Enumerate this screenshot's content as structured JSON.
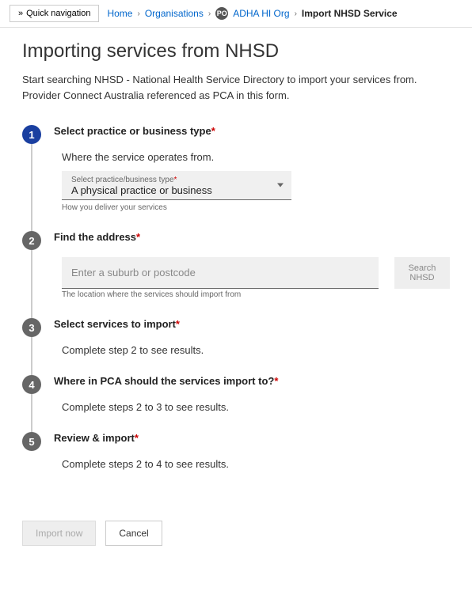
{
  "topbar": {
    "quicknav": "Quick navigation",
    "crumbs": {
      "home": "Home",
      "orgs": "Organisations",
      "org_badge": "PO",
      "org_name": "ADHA HI Org",
      "current": "Import NHSD Service"
    }
  },
  "page": {
    "title": "Importing services from NHSD",
    "intro_line1": "Start searching NHSD - National Health Service Directory to import your services from.",
    "intro_line2": "Provider Connect Australia referenced as PCA in this form."
  },
  "steps": {
    "s1": {
      "num": "1",
      "title": "Select practice or business type",
      "field_label": "Where the service operates from.",
      "select_floating": "Select practice/business type",
      "select_value": "A physical practice or business",
      "helper": "How you deliver your services"
    },
    "s2": {
      "num": "2",
      "title": "Find the address",
      "placeholder": "Enter a suburb or postcode",
      "search_btn": "Search NHSD",
      "helper": "The location where the services should import from"
    },
    "s3": {
      "num": "3",
      "title": "Select services to import",
      "note": "Complete step 2 to see results."
    },
    "s4": {
      "num": "4",
      "title": "Where in PCA should the services import to?",
      "note": "Complete steps 2 to 3 to see results."
    },
    "s5": {
      "num": "5",
      "title": "Review & import",
      "note": "Complete steps 2 to 4 to see results."
    }
  },
  "actions": {
    "import": "Import now",
    "cancel": "Cancel"
  }
}
